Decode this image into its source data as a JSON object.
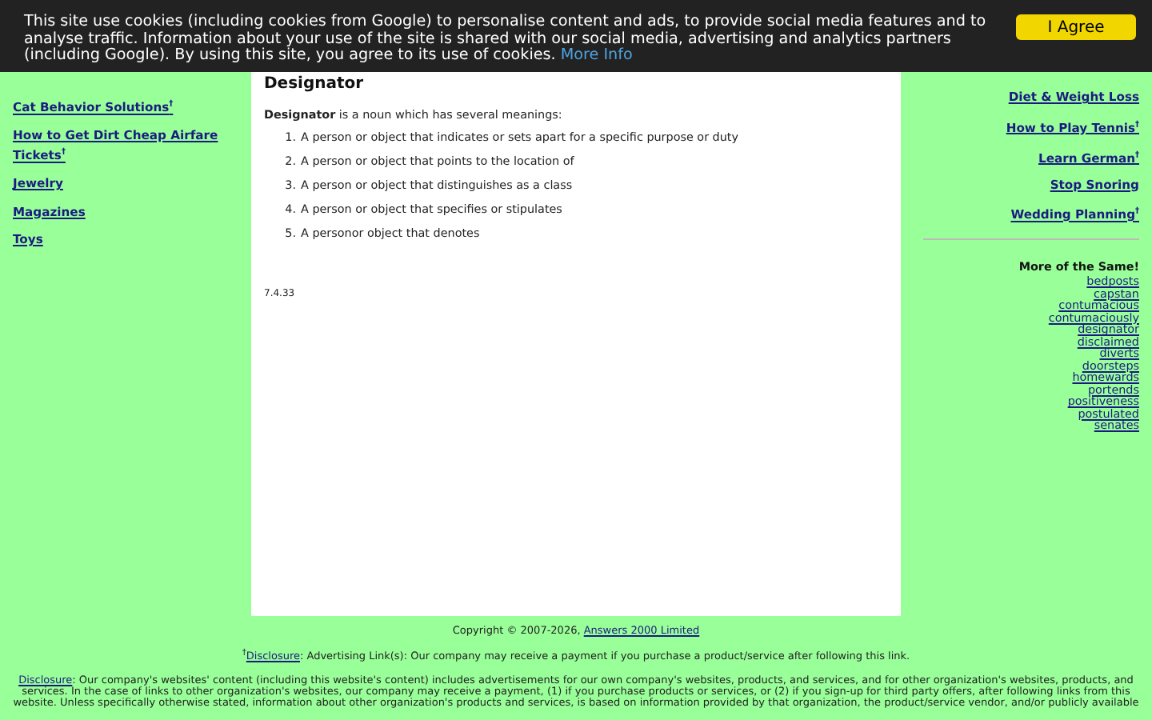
{
  "cookie_banner": {
    "text": "This site use cookies (including cookies from Google) to personalise content and ads, to provide social media features and to analyse traffic. Information about your use of the site is shared with our social media, advertising and analytics partners (including Google). By using this site, you agree to its use of cookies.",
    "link": "More Info",
    "button": "I Agree"
  },
  "left_links": [
    {
      "label": "Cat Behavior Solutions",
      "dagger": "†"
    },
    {
      "label": "How to Get Dirt Cheap Airfare Tickets",
      "dagger": "†"
    },
    {
      "label": "Jewelry"
    },
    {
      "label": "Magazines"
    },
    {
      "label": "Toys"
    }
  ],
  "article": {
    "title": "Designator",
    "intro": "**Designator** is a noun which has several meanings:",
    "meanings": [
      {
        "number": "1.",
        "text": "A person or object that indicates or sets apart for a specific purpose or duty"
      },
      {
        "number": "2.",
        "text": "A person or object that points to the location of"
      },
      {
        "number": "3.",
        "text": "A person or object that distinguishes as a class"
      },
      {
        "number": "4.",
        "text": "A person or object that specifies or stipulates"
      },
      {
        "number": "5.",
        "text": "A personor object that denotes"
      }
    ],
    "version": "7.4.33"
  },
  "right_links": [
    {
      "label": "Diet & Weight Loss"
    },
    {
      "label": "How to Play Tennis",
      "dagger": "†"
    },
    {
      "label": "Learn German",
      "dagger": "†"
    },
    {
      "label": "Stop Snoring"
    },
    {
      "label": "Wedding Planning",
      "dagger": "†"
    }
  ],
  "more": {
    "heading": "More of the Same!",
    "words": [
      "bedposts",
      "capstan",
      "contumacious",
      "contumaciously",
      "designator",
      "disclaimed",
      "diverts",
      "doorsteps",
      "homewards",
      "portends",
      "positiveness",
      "postulated",
      "senates"
    ]
  },
  "footer": {
    "copyright": "Copyright © 2007-2026,",
    "company": "Answers 2000 Limited",
    "dagger": "†",
    "note_link": "Disclosure",
    "disclosure_note": ": Advertising Link(s): Our company may receive a payment if you purchase a product/service after following this link.",
    "text_link": "Disclosure",
    "disclosure_text": ": Our company's websites' content (including this website's content) includes advertisements for our own company's websites, products, and services, and for other organization's websites, products, and services. In the case of links to other organization's websites, our company may receive a payment, (1) if you purchase products or services, or (2) if you sign-up for third party offers, after following links from this website. Unless specifically otherwise stated, information about other organization's products and services, is based on information provided by that organization, the product/service vendor, and/or publicly available"
  }
}
